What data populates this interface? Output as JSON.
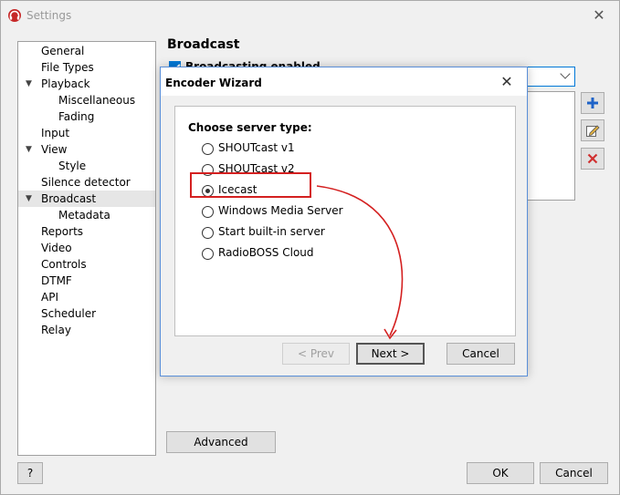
{
  "window": {
    "title": "Settings"
  },
  "tree": {
    "items": [
      {
        "label": "General",
        "indent": 0,
        "expander": false,
        "selected": false
      },
      {
        "label": "File Types",
        "indent": 0,
        "expander": false,
        "selected": false
      },
      {
        "label": "Playback",
        "indent": 0,
        "expander": true,
        "selected": false
      },
      {
        "label": "Miscellaneous",
        "indent": 1,
        "expander": false,
        "selected": false
      },
      {
        "label": "Fading",
        "indent": 1,
        "expander": false,
        "selected": false
      },
      {
        "label": "Input",
        "indent": 0,
        "expander": false,
        "selected": false
      },
      {
        "label": "View",
        "indent": 0,
        "expander": true,
        "selected": false
      },
      {
        "label": "Style",
        "indent": 1,
        "expander": false,
        "selected": false
      },
      {
        "label": "Silence detector",
        "indent": 0,
        "expander": false,
        "selected": false
      },
      {
        "label": "Broadcast",
        "indent": 0,
        "expander": true,
        "selected": true
      },
      {
        "label": "Metadata",
        "indent": 1,
        "expander": false,
        "selected": false
      },
      {
        "label": "Reports",
        "indent": 0,
        "expander": false,
        "selected": false
      },
      {
        "label": "Video",
        "indent": 0,
        "expander": false,
        "selected": false
      },
      {
        "label": "Controls",
        "indent": 0,
        "expander": false,
        "selected": false
      },
      {
        "label": "DTMF",
        "indent": 0,
        "expander": false,
        "selected": false
      },
      {
        "label": "API",
        "indent": 0,
        "expander": false,
        "selected": false
      },
      {
        "label": "Scheduler",
        "indent": 0,
        "expander": false,
        "selected": false
      },
      {
        "label": "Relay",
        "indent": 0,
        "expander": false,
        "selected": false
      }
    ]
  },
  "broadcast": {
    "title": "Broadcast",
    "enabled_label": "Broadcasting enabled",
    "advanced_label": "Advanced"
  },
  "footer": {
    "help_label": "?",
    "ok_label": "OK",
    "cancel_label": "Cancel"
  },
  "wizard": {
    "title": "Encoder Wizard",
    "heading": "Choose server type:",
    "options": [
      {
        "label": "SHOUTcast v1",
        "selected": false
      },
      {
        "label": "SHOUTcast v2",
        "selected": false
      },
      {
        "label": "Icecast",
        "selected": true
      },
      {
        "label": "Windows Media Server",
        "selected": false
      },
      {
        "label": "Start built-in server",
        "selected": false
      },
      {
        "label": "RadioBOSS Cloud",
        "selected": false
      }
    ],
    "prev_label": "< Prev",
    "next_label": "Next >",
    "cancel_label": "Cancel"
  },
  "colors": {
    "accent": "#0078d7",
    "annotation": "#d42020"
  },
  "icons": {
    "add": "plus-icon",
    "edit": "edit-icon",
    "remove": "delete-icon"
  }
}
